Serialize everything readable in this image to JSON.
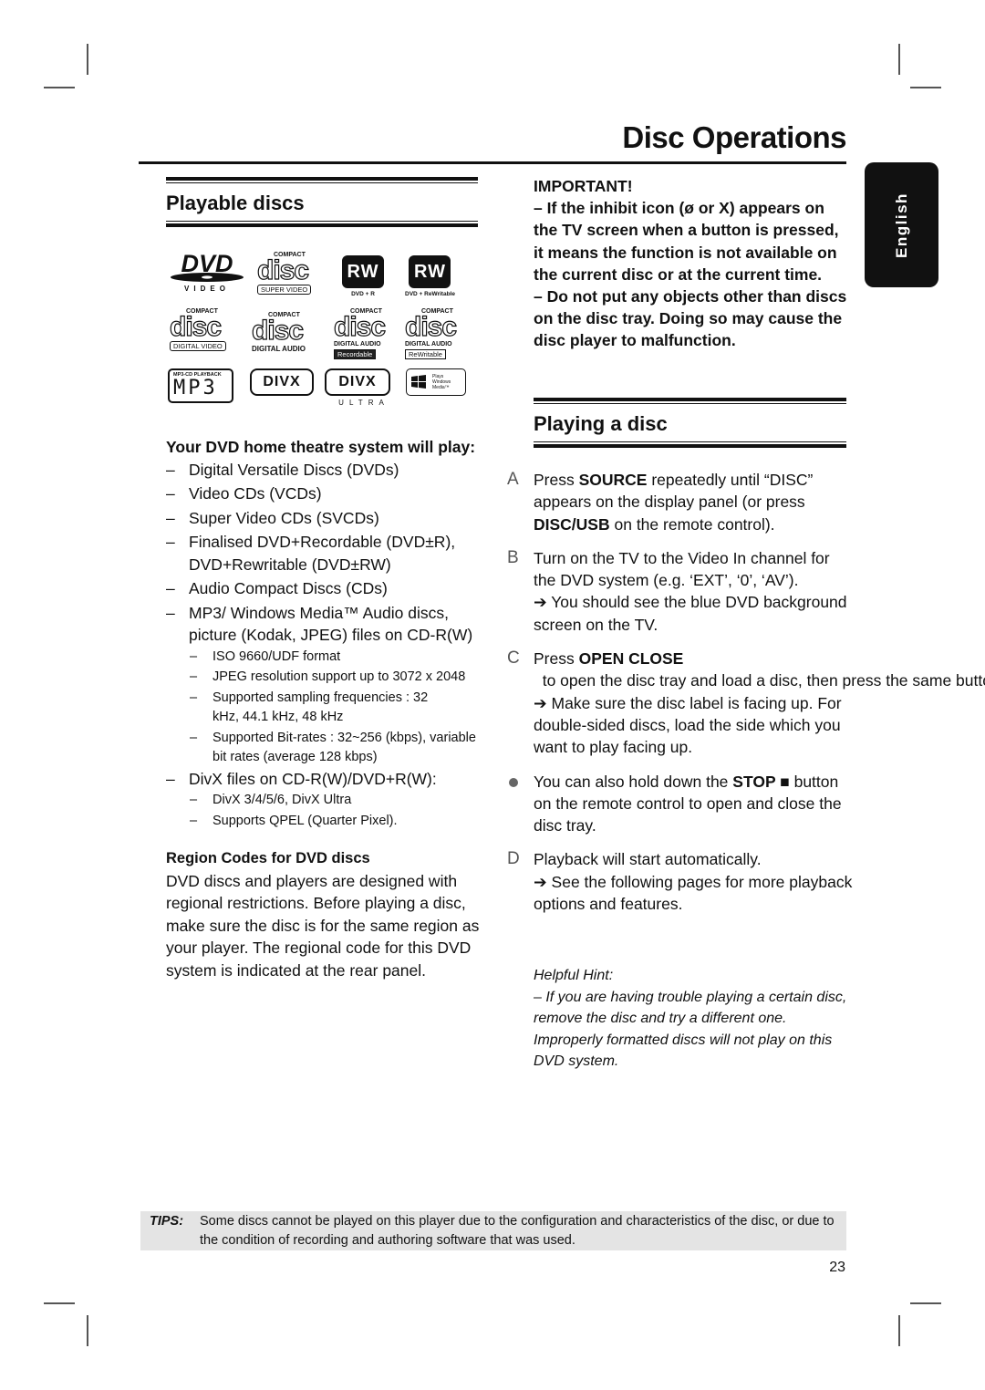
{
  "page": {
    "title": "Disc Operations",
    "language_tab": "English",
    "page_number": "23"
  },
  "playable_discs": {
    "heading": "Playable discs",
    "logos": [
      {
        "name": "dvd-video-logo",
        "text": "DVD",
        "caption": "VIDEO"
      },
      {
        "name": "compact-disc-super-video-logo",
        "top": "COMPACT",
        "word": "disc",
        "caption": "SUPER VIDEO"
      },
      {
        "name": "dvd-plus-r-logo",
        "text": "RW",
        "caption": "DVD + R"
      },
      {
        "name": "dvd-plus-rewritable-logo",
        "text": "RW",
        "caption": "DVD + ReWritable"
      },
      {
        "name": "compact-disc-digital-video-logo",
        "top": "COMPACT",
        "word": "disc",
        "caption": "DIGITAL VIDEO"
      },
      {
        "name": "compact-disc-digital-audio-logo",
        "top": "COMPACT",
        "word": "disc",
        "caption": "DIGITAL AUDIO"
      },
      {
        "name": "compact-disc-recordable-logo",
        "top": "COMPACT",
        "word": "disc",
        "caption": "DIGITAL AUDIO",
        "caption2": "Recordable"
      },
      {
        "name": "compact-disc-rewritable-logo",
        "top": "COMPACT",
        "word": "disc",
        "caption": "DIGITAL AUDIO",
        "caption2": "ReWritable"
      },
      {
        "name": "mp3-cd-playback-logo",
        "top": "MP3-CD PLAYBACK",
        "text": "MP3"
      },
      {
        "name": "divx-logo",
        "text": "DIVX"
      },
      {
        "name": "divx-ultra-logo",
        "text": "DIVX",
        "caption": "ULTRA"
      },
      {
        "name": "windows-media-logo",
        "line1": "Plays",
        "line2": "Windows",
        "line3": "Media™"
      }
    ],
    "will_play_heading": "Your DVD home theatre system will play:",
    "items": [
      "Digital Versatile Discs (DVDs)",
      "Video CDs (VCDs)",
      "Super Video CDs (SVCDs)",
      "Finalised DVD+Recordable (DVD±R), DVD+Rewritable (DVD±RW)",
      "Audio Compact Discs (CDs)",
      "MP3/ Windows Media™ Audio discs, picture (Kodak, JPEG) files on CD-R(W)"
    ],
    "mp3_subitems": [
      "ISO 9660/UDF format",
      "JPEG resolution support up to 3072 x 2048",
      "Supported sampling frequencies : 32 kHz, 44.1 kHz, 48 kHz",
      "Supported Bit-rates : 32~256 (kbps), variable bit rates (average 128 kbps)"
    ],
    "divx_item": "DivX files on CD-R(W)/DVD+R(W):",
    "divx_subitems": [
      "DivX 3/4/5/6, DivX Ultra",
      "Supports QPEL (Quarter Pixel)."
    ],
    "region_heading": "Region Codes for DVD discs",
    "region_text": "DVD discs and players are designed with regional restrictions. Before playing a disc, make sure the disc is for the same region as your player.  The regional code for this DVD system is indicated at the rear panel."
  },
  "important": {
    "heading": "IMPORTANT!",
    "note1": "– If the inhibit icon (ø or X) appears on the TV screen when a button is pressed, it means the function is not available on the current disc or at the current time.",
    "note2": "– Do not put any objects other than discs on the disc tray.  Doing so may cause the disc player to malfunction."
  },
  "playing_disc": {
    "heading": "Playing a disc",
    "steps": [
      {
        "marker": "A",
        "pre": "Press ",
        "bold1": "SOURCE",
        "mid": " repeatedly until “DISC” appears on the display panel (or press ",
        "bold2": "DISC/USB",
        "post": " on the remote control)."
      },
      {
        "marker": "B",
        "text": "Turn on the TV to the Video In channel for the DVD system (e.g. ‘EXT’, ‘0’, ‘AV’).",
        "result": "You should see the blue DVD background screen on the TV."
      },
      {
        "marker": "C",
        "pre": "Press ",
        "bold1": "OPEN CLOSE",
        "post": "  to open the disc tray and load a disc, then press the same button again to close the disc tray.",
        "result": "Make sure the disc label is facing up. For double-sided discs, load the side which you want to play facing up."
      },
      {
        "marker": "●",
        "pre": "You can also hold down the ",
        "bold1": "STOP ■",
        "post": " button on the remote control to open and close the disc tray."
      },
      {
        "marker": "D",
        "text": "Playback will start automatically.",
        "result": "See the following pages for more playback options and features."
      }
    ],
    "arrow": "➔",
    "hint_title": "Helpful Hint:",
    "hint_text": "– If you are having trouble playing a certain disc, remove the disc and try a different one. Improperly formatted discs will not play on this DVD system."
  },
  "tips": {
    "label": "TIPS:",
    "text": "Some discs cannot be played on this player due to the configuration and characteristics of the disc, or due to the condition of recording and authoring software that was used."
  }
}
